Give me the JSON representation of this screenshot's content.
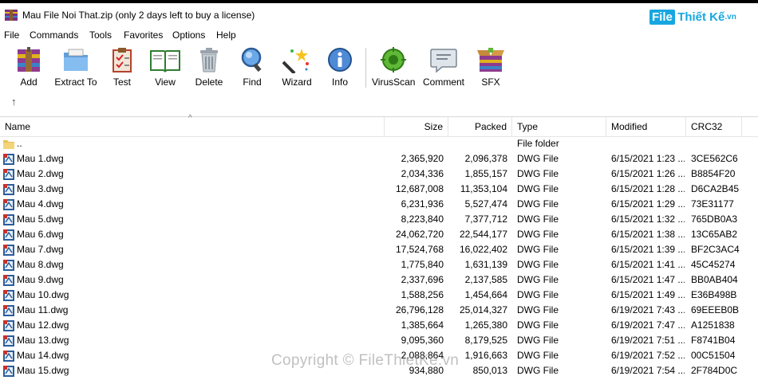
{
  "window": {
    "title": "Mau File Noi That.zip (only 2 days left to buy a license)"
  },
  "brand": {
    "box": "File",
    "rest": "Thiết Kế",
    "tld": ".vn"
  },
  "menu": [
    "File",
    "Commands",
    "Tools",
    "Favorites",
    "Options",
    "Help"
  ],
  "toolbar": [
    {
      "label": "Add",
      "icon": "add-archive-icon"
    },
    {
      "label": "Extract To",
      "icon": "extract-folder-icon"
    },
    {
      "label": "Test",
      "icon": "test-clipboard-icon"
    },
    {
      "label": "View",
      "icon": "view-book-icon"
    },
    {
      "label": "Delete",
      "icon": "trash-icon"
    },
    {
      "label": "Find",
      "icon": "magnifier-icon"
    },
    {
      "label": "Wizard",
      "icon": "magic-wand-icon"
    },
    {
      "label": "Info",
      "icon": "info-icon"
    },
    {
      "label": "VirusScan",
      "icon": "virus-scan-icon"
    },
    {
      "label": "Comment",
      "icon": "comment-icon"
    },
    {
      "label": "SFX",
      "icon": "sfx-box-icon"
    }
  ],
  "up_arrow": "↑",
  "columns": {
    "name": "Name",
    "size": "Size",
    "packed": "Packed",
    "type": "Type",
    "modified": "Modified",
    "crc": "CRC32"
  },
  "files": [
    {
      "name": "..",
      "size": "",
      "packed": "",
      "type": "File folder",
      "modified": "",
      "crc": "",
      "folder": true
    },
    {
      "name": "Mau 1.dwg",
      "size": "2,365,920",
      "packed": "2,096,378",
      "type": "DWG File",
      "modified": "6/15/2021 1:23 ...",
      "crc": "3CE562C6"
    },
    {
      "name": "Mau 2.dwg",
      "size": "2,034,336",
      "packed": "1,855,157",
      "type": "DWG File",
      "modified": "6/15/2021 1:26 ...",
      "crc": "B8854F20"
    },
    {
      "name": "Mau 3.dwg",
      "size": "12,687,008",
      "packed": "11,353,104",
      "type": "DWG File",
      "modified": "6/15/2021 1:28 ...",
      "crc": "D6CA2B45"
    },
    {
      "name": "Mau 4.dwg",
      "size": "6,231,936",
      "packed": "5,527,474",
      "type": "DWG File",
      "modified": "6/15/2021 1:29 ...",
      "crc": "73E31177"
    },
    {
      "name": "Mau 5.dwg",
      "size": "8,223,840",
      "packed": "7,377,712",
      "type": "DWG File",
      "modified": "6/15/2021 1:32 ...",
      "crc": "765DB0A3"
    },
    {
      "name": "Mau 6.dwg",
      "size": "24,062,720",
      "packed": "22,544,177",
      "type": "DWG File",
      "modified": "6/15/2021 1:38 ...",
      "crc": "13C65AB2"
    },
    {
      "name": "Mau 7.dwg",
      "size": "17,524,768",
      "packed": "16,022,402",
      "type": "DWG File",
      "modified": "6/15/2021 1:39 ...",
      "crc": "BF2C3AC4"
    },
    {
      "name": "Mau 8.dwg",
      "size": "1,775,840",
      "packed": "1,631,139",
      "type": "DWG File",
      "modified": "6/15/2021 1:41 ...",
      "crc": "45C45274"
    },
    {
      "name": "Mau 9.dwg",
      "size": "2,337,696",
      "packed": "2,137,585",
      "type": "DWG File",
      "modified": "6/15/2021 1:47 ...",
      "crc": "BB0AB404"
    },
    {
      "name": "Mau 10.dwg",
      "size": "1,588,256",
      "packed": "1,454,664",
      "type": "DWG File",
      "modified": "6/15/2021 1:49 ...",
      "crc": "E36B498B"
    },
    {
      "name": "Mau 11.dwg",
      "size": "26,796,128",
      "packed": "25,014,327",
      "type": "DWG File",
      "modified": "6/19/2021 7:43 ...",
      "crc": "69EEEB0B"
    },
    {
      "name": "Mau 12.dwg",
      "size": "1,385,664",
      "packed": "1,265,380",
      "type": "DWG File",
      "modified": "6/19/2021 7:47 ...",
      "crc": "A1251838"
    },
    {
      "name": "Mau 13.dwg",
      "size": "9,095,360",
      "packed": "8,179,525",
      "type": "DWG File",
      "modified": "6/19/2021 7:51 ...",
      "crc": "F8741B04"
    },
    {
      "name": "Mau 14.dwg",
      "size": "2,088,864",
      "packed": "1,916,663",
      "type": "DWG File",
      "modified": "6/19/2021 7:52 ...",
      "crc": "00C51504"
    },
    {
      "name": "Mau 15.dwg",
      "size": "934,880",
      "packed": "850,013",
      "type": "DWG File",
      "modified": "6/19/2021 7:54 ...",
      "crc": "2F784D0C"
    }
  ],
  "watermark": "Copyright © FileThietKe.vn"
}
